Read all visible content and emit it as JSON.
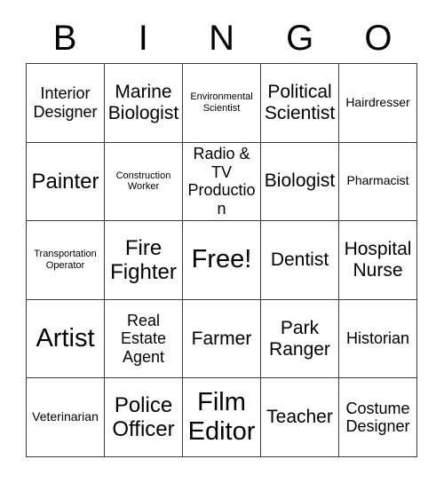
{
  "card": {
    "header_letters": [
      "B",
      "I",
      "N",
      "G",
      "O"
    ],
    "grid": {
      "columns": 5,
      "rows": 5,
      "border_color": "#3b3b3b",
      "background_color": "#ffffff",
      "text_color": "#000000",
      "cells": [
        [
          {
            "text": "Interior Designer",
            "size": "m"
          },
          {
            "text": "Marine Biologist",
            "size": "l"
          },
          {
            "text": "Environmental Scientist",
            "size": "xs"
          },
          {
            "text": "Political Scientist",
            "size": "l"
          },
          {
            "text": "Hairdresser",
            "size": "s"
          }
        ],
        [
          {
            "text": "Painter",
            "size": "xl"
          },
          {
            "text": "Construction Worker",
            "size": "xs"
          },
          {
            "text": "Radio & TV Production",
            "size": "m"
          },
          {
            "text": "Biologist",
            "size": "l"
          },
          {
            "text": "Pharmacist",
            "size": "s"
          }
        ],
        [
          {
            "text": "Transportation Operator",
            "size": "xs"
          },
          {
            "text": "Fire Fighter",
            "size": "xl"
          },
          {
            "text": "Free!",
            "size": "xxl"
          },
          {
            "text": "Dentist",
            "size": "l"
          },
          {
            "text": "Hospital Nurse",
            "size": "l"
          }
        ],
        [
          {
            "text": "Artist",
            "size": "xxl"
          },
          {
            "text": "Real Estate Agent",
            "size": "m"
          },
          {
            "text": "Farmer",
            "size": "l"
          },
          {
            "text": "Park Ranger",
            "size": "l"
          },
          {
            "text": "Historian",
            "size": "m"
          }
        ],
        [
          {
            "text": "Veterinarian",
            "size": "s"
          },
          {
            "text": "Police Officer",
            "size": "xl"
          },
          {
            "text": "Film Editor",
            "size": "xxl"
          },
          {
            "text": "Teacher",
            "size": "l"
          },
          {
            "text": "Costume Designer",
            "size": "m"
          }
        ]
      ]
    }
  }
}
